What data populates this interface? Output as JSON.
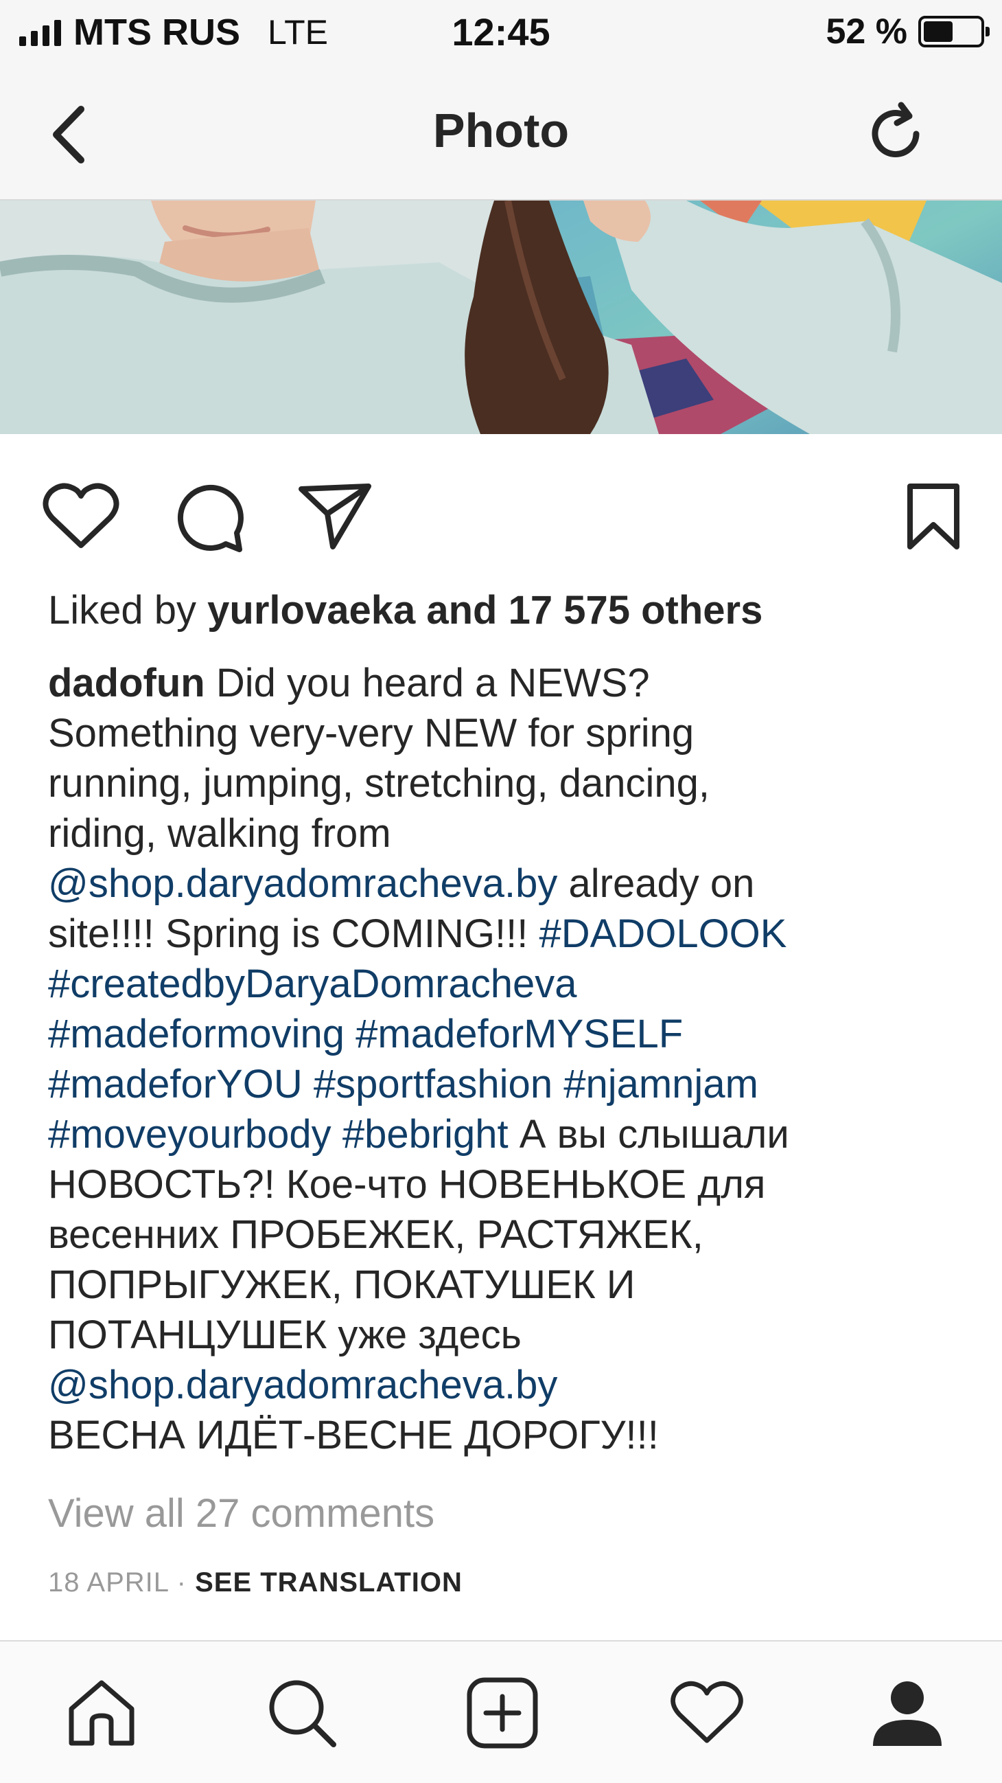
{
  "status_bar": {
    "carrier": "MTS RUS",
    "network": "LTE",
    "time": "12:45",
    "battery": "52 %",
    "battery_level": 0.52
  },
  "nav": {
    "title": "Photo",
    "back_icon": "chevron-left-icon",
    "refresh_icon": "refresh-icon"
  },
  "post": {
    "likes": {
      "prefix": "Liked by",
      "user": "yurlovaeka",
      "suffix": "and 17 575 others"
    },
    "caption": {
      "username": "dadofun",
      "line1_text": " Did you heard a NEWS?",
      "line2": "Something very-very NEW for spring",
      "line3": "running, jumping, stretching, dancing,",
      "line4": "riding, walking from",
      "line5_link": "@shop.daryadomracheva.by",
      "line5_text": " already on",
      "line6_text": "site!!!! Spring is COMING!!! ",
      "line6_tag": "#DADOLOOK",
      "line7_tag": "#createdbyDaryaDomracheva",
      "line8_tag1": "#madeformoving",
      "line8_tag2": "#madeforMYSELF",
      "line9_tag1": "#madeforYOU",
      "line9_tag2": "#sportfashion",
      "line9_tag3": "#njamnjam",
      "line10_tag1": "#moveyourbody",
      "line10_tag2": "#bebright",
      "line10_text": "  А вы слышали",
      "line11": "НОВОСТЬ?! Кое-что  НОВЕНЬКОЕ для",
      "line12": "весенних ПРОБЕЖЕК, РАСТЯЖЕК,",
      "line13": "ПОПРЫГУЖЕК, ПОКАТУШЕК И",
      "line14": "ПОТАНЦУШЕК уже здесь",
      "line15_link": "@shop.daryadomracheva.by",
      "line16": "ВЕСНА ИДЁТ-ВЕСНЕ ДОРОГУ!!!"
    },
    "view_comments": "View all 27 comments",
    "date": "18 APRIL",
    "separator": " · ",
    "see_translation": "SEE TRANSLATION"
  },
  "colors": {
    "link": "#103d67",
    "text": "#262626",
    "muted": "#999999"
  },
  "tabs": [
    {
      "name": "home-icon"
    },
    {
      "name": "search-icon"
    },
    {
      "name": "add-post-icon"
    },
    {
      "name": "activity-heart-icon"
    },
    {
      "name": "profile-icon"
    }
  ]
}
